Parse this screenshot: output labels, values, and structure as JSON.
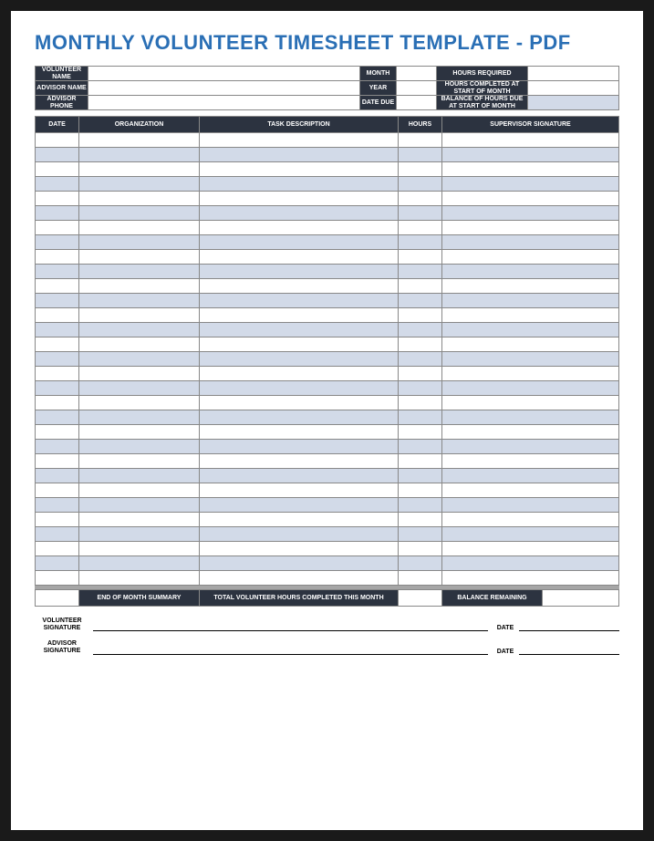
{
  "title": "MONTHLY VOLUNTEER TIMESHEET TEMPLATE - PDF",
  "header": {
    "volunteer_name_label": "VOLUNTEER NAME",
    "advisor_name_label": "ADVISOR NAME",
    "advisor_phone_label": "ADVISOR PHONE",
    "month_label": "MONTH",
    "year_label": "YEAR",
    "date_due_label": "DATE DUE",
    "hours_required_label": "HOURS REQUIRED",
    "hours_completed_label": "HOURS COMPLETED AT START OF MONTH",
    "balance_label": "BALANCE OF HOURS DUE AT START OF MONTH",
    "volunteer_name": "",
    "advisor_name": "",
    "advisor_phone": "",
    "month": "",
    "year": "",
    "date_due": "",
    "hours_required": "",
    "hours_completed": "",
    "balance": ""
  },
  "columns": {
    "date": "DATE",
    "organization": "ORGANIZATION",
    "task": "TASK DESCRIPTION",
    "hours": "HOURS",
    "signature": "SUPERVISOR SIGNATURE"
  },
  "rows": 31,
  "summary": {
    "eom_label": "END OF MONTH SUMMARY",
    "total_label": "TOTAL VOLUNTEER HOURS COMPLETED THIS MONTH",
    "balance_label": "BALANCE REMAINING",
    "total_value": "",
    "balance_value": ""
  },
  "sign": {
    "volunteer_label": "VOLUNTEER SIGNATURE",
    "advisor_label": "ADVISOR SIGNATURE",
    "date_label": "DATE"
  }
}
